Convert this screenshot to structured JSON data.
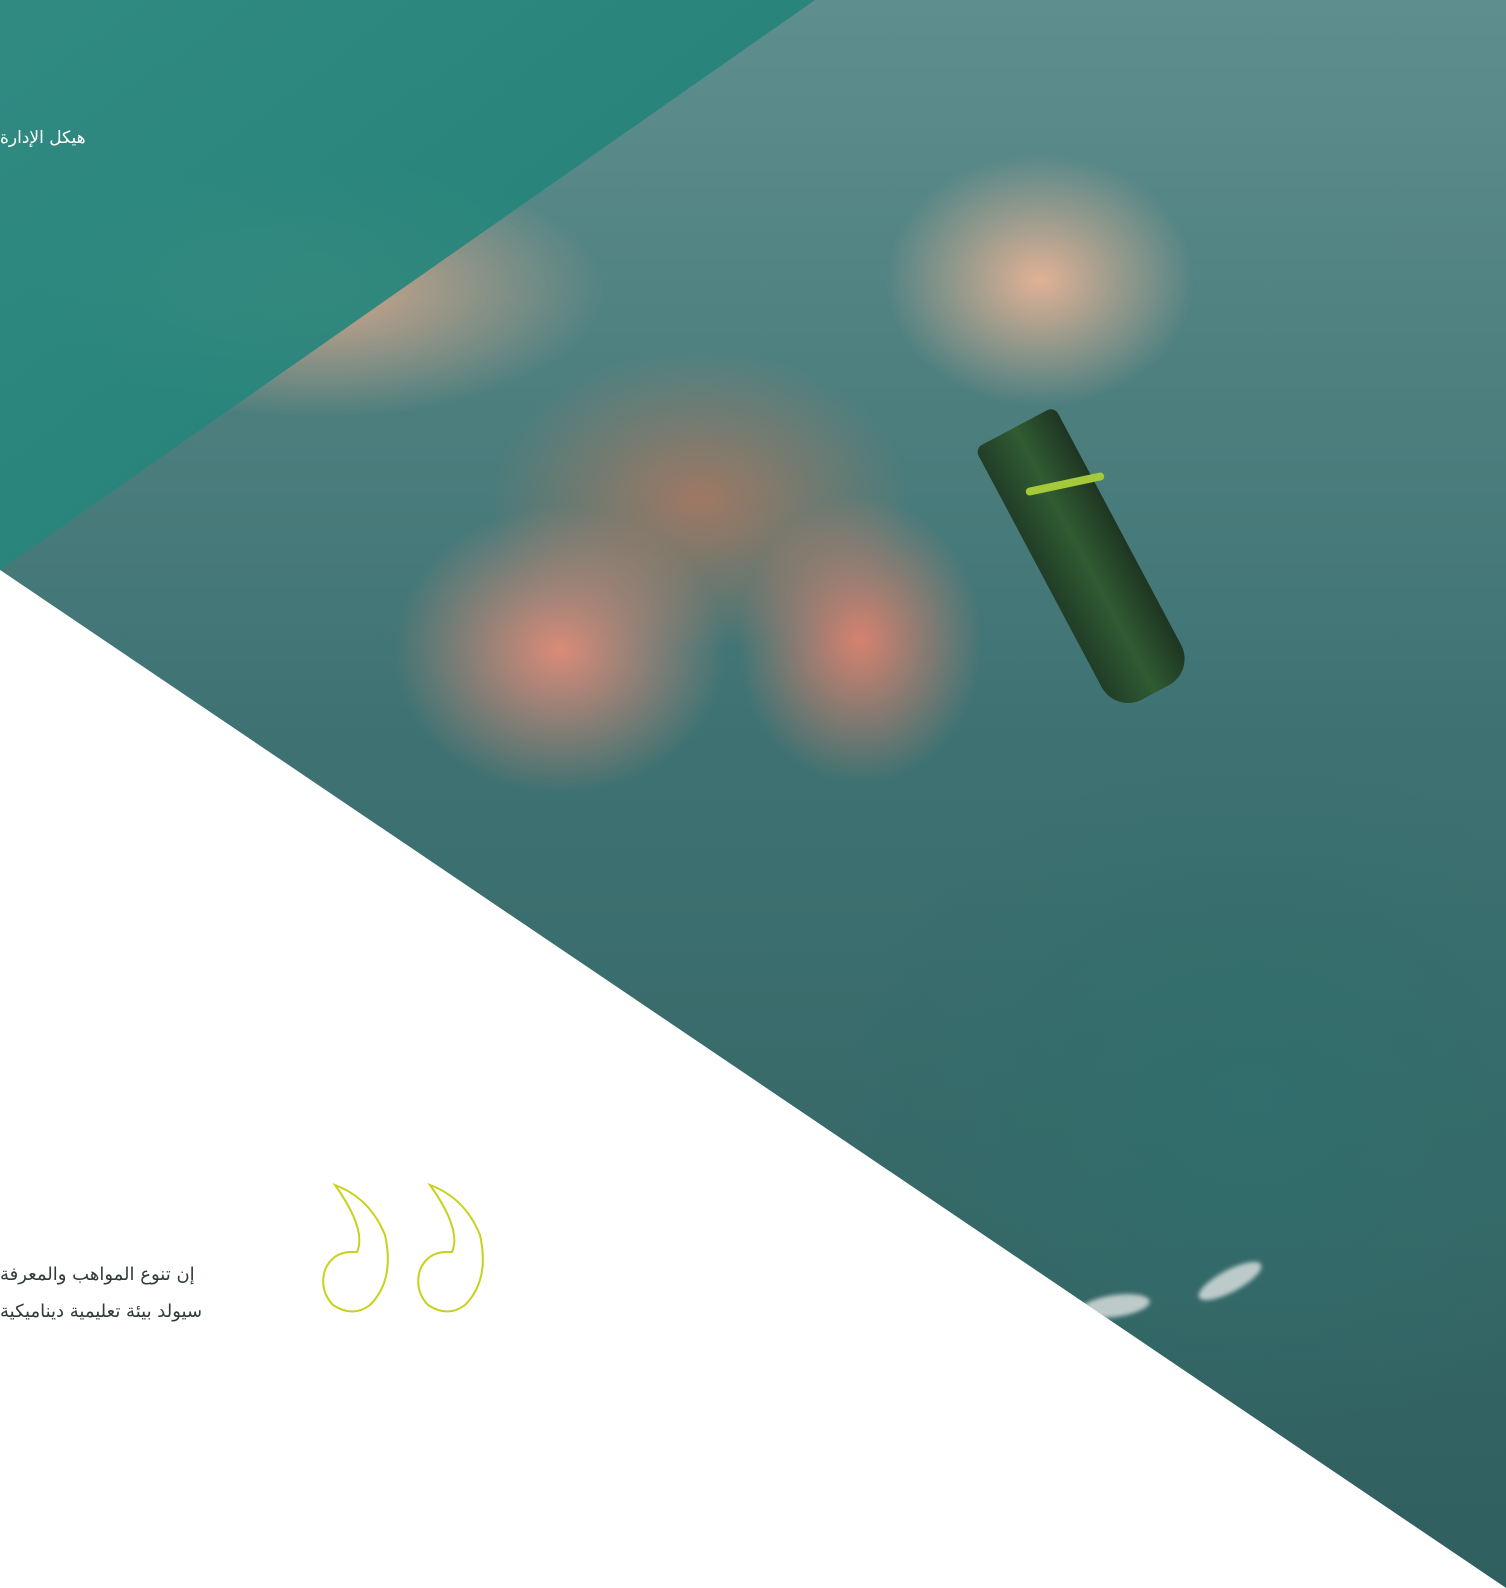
{
  "header": {
    "breadcrumb": "هيكل الإدارة"
  },
  "quote": {
    "line1": "إن تنوع المواهب والمعرفة",
    "line2": "سيولد بيئة تعليمية ديناميكية"
  },
  "colors": {
    "teal": "#1f8074",
    "quote_mark": "#c9d21a",
    "text_dark": "#2f3b3b"
  },
  "icons": {
    "quote": "quote-mark-icon"
  }
}
